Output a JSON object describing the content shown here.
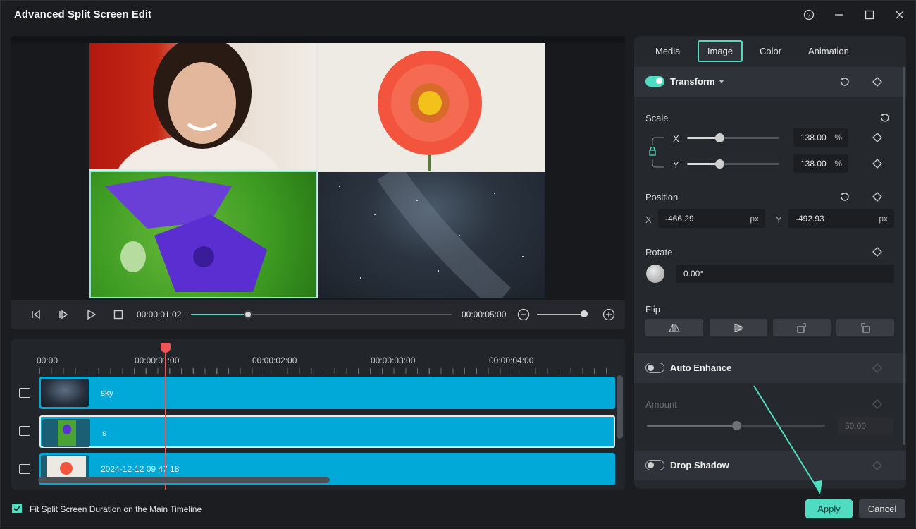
{
  "window": {
    "title": "Advanced Split Screen Edit"
  },
  "preview": {
    "current_time": "00:00:01:02",
    "total_time": "00:00:05:00",
    "progress": 0.22,
    "zoom_level": 0.9
  },
  "timeline": {
    "ruler_labels": [
      "00:00",
      "00:00:01:00",
      "00:00:02:00",
      "00:00:03:00",
      "00:00:04:00"
    ],
    "tracks": [
      {
        "label": "sky"
      },
      {
        "label": "s"
      },
      {
        "label": "2024-12-12 09 47 18"
      }
    ]
  },
  "panel": {
    "tabs": [
      "Media",
      "Image",
      "Color",
      "Animation"
    ],
    "active_tab": "Image",
    "transform": {
      "title": "Transform",
      "enabled": true,
      "scale_label": "Scale",
      "scale_x_label": "X",
      "scale_y_label": "Y",
      "scale_x": "138.00",
      "scale_y": "138.00",
      "scale_unit": "%",
      "position_label": "Position",
      "pos_x_label": "X",
      "pos_y_label": "Y",
      "pos_x": "-466.29",
      "pos_y": "-492.93",
      "pos_unit": "px",
      "rotate_label": "Rotate",
      "rotate_value": "0.00°",
      "flip_label": "Flip"
    },
    "auto_enhance": {
      "title": "Auto Enhance",
      "enabled": false,
      "amount_label": "Amount",
      "amount_value": "50.00"
    },
    "drop_shadow": {
      "title": "Drop Shadow",
      "enabled": false
    }
  },
  "footer": {
    "fit_label": "Fit Split Screen Duration on the Main Timeline",
    "fit_checked": true,
    "apply_label": "Apply",
    "cancel_label": "Cancel"
  },
  "colors": {
    "accent": "#4fdcc0",
    "track": "#00a9d7",
    "playhead": "#f05454"
  }
}
